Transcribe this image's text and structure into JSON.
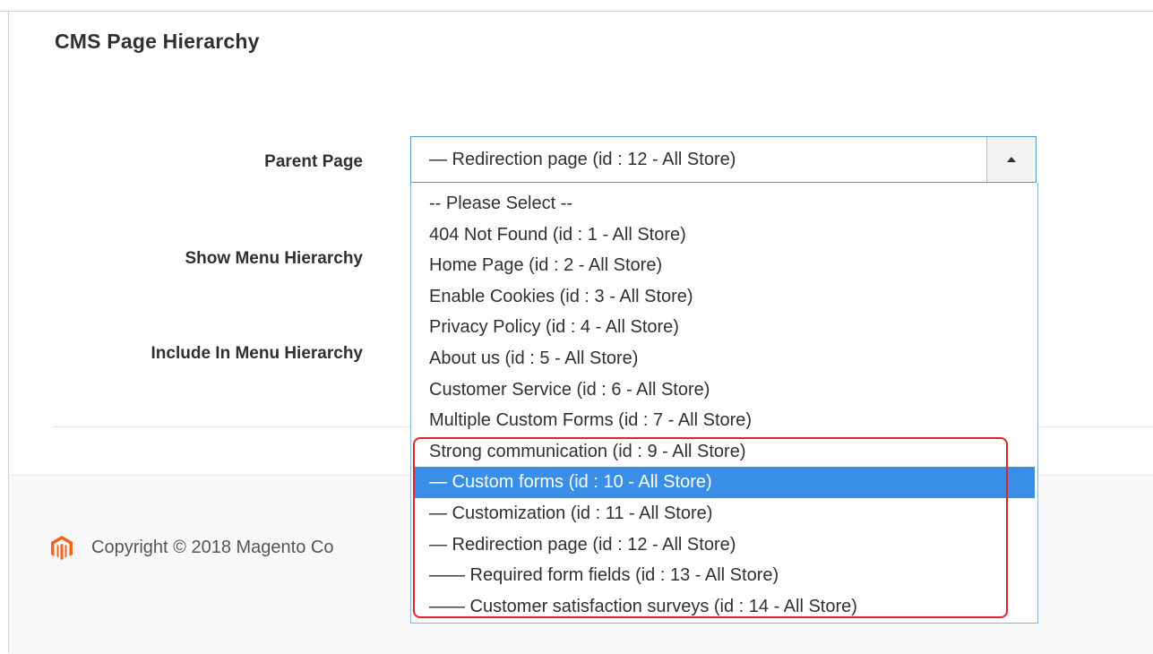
{
  "section": {
    "title": "CMS Page Hierarchy"
  },
  "form": {
    "parent_page_label": "Parent Page",
    "show_menu_label": "Show Menu Hierarchy",
    "include_menu_label": "Include In Menu Hierarchy",
    "parent_page_value": "— Redirection page (id : 12 - All Store)"
  },
  "dropdown": {
    "options": [
      "-- Please Select --",
      "404 Not Found (id : 1 - All Store)",
      "Home Page (id : 2 - All Store)",
      "Enable Cookies (id : 3 - All Store)",
      "Privacy Policy (id : 4 - All Store)",
      "About us (id : 5 - All Store)",
      "Customer Service (id : 6 - All Store)",
      "Multiple Custom Forms (id : 7 - All Store)",
      "Strong communication (id : 9 - All Store)",
      "— Custom forms (id : 10 - All Store)",
      "— Customization (id : 11 - All Store)",
      "— Redirection page (id : 12 - All Store)",
      "—— Required form fields (id : 13 - All Store)",
      "—— Customer satisfaction surveys (id : 14 - All Store)"
    ],
    "selected_option": "— Custom forms (id : 10 - All Store)"
  },
  "footer": {
    "copyright": "Copyright © 2018 Magento Co"
  },
  "colors": {
    "highlight_border": "#e0242b",
    "selected_bg": "#3a8ee6",
    "select_border": "#4f9ccf",
    "magento_orange": "#f26322"
  },
  "icons": {
    "footer_logo": "magento-logo-icon",
    "select_arrow": "triangle-up-icon"
  }
}
